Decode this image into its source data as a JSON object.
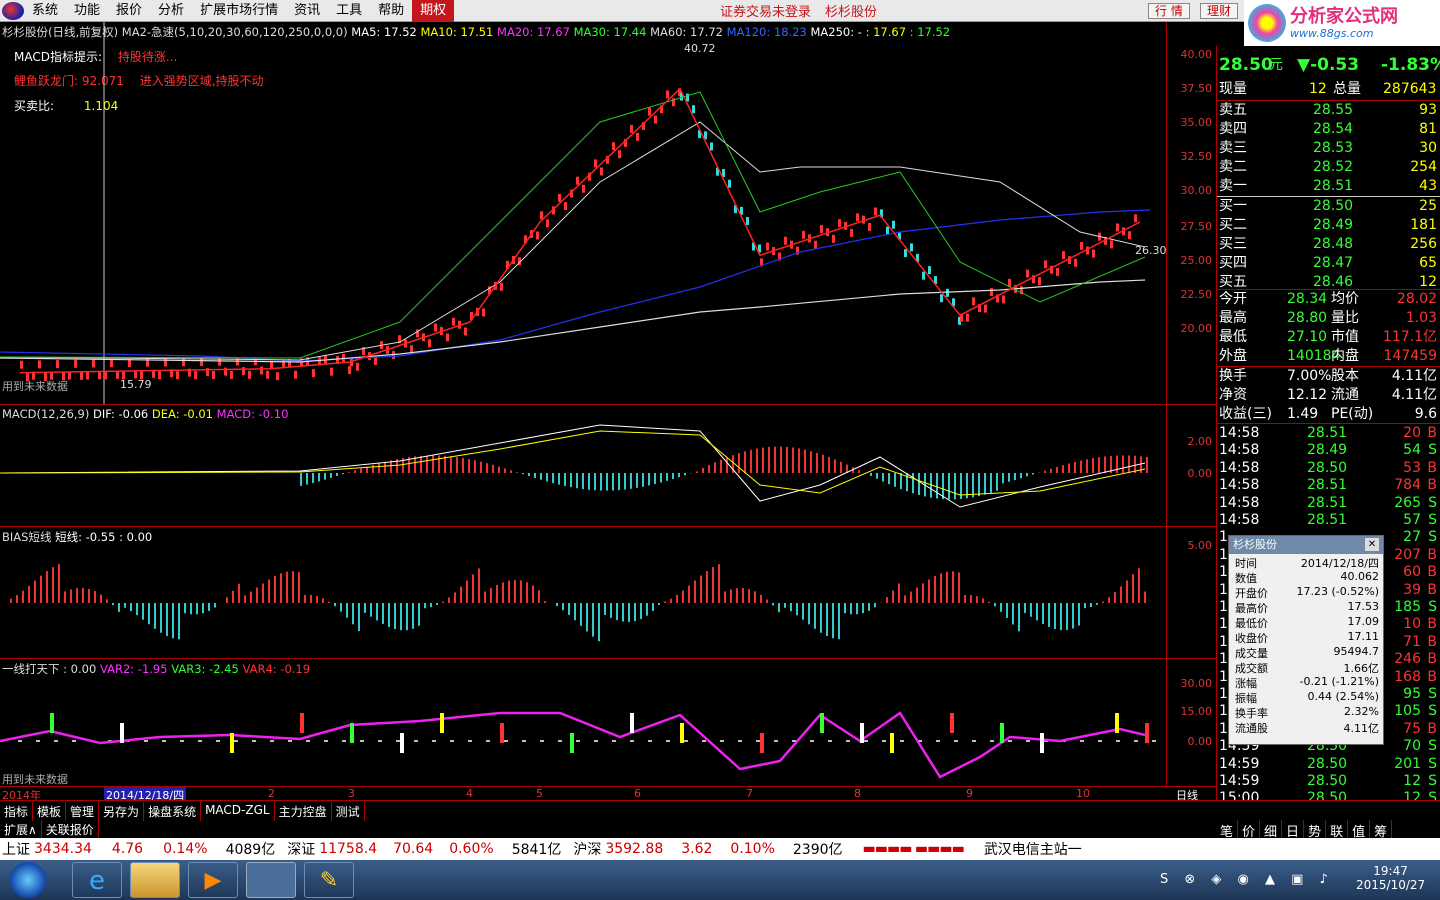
{
  "menu": {
    "items": [
      "系统",
      "功能",
      "报价",
      "分析",
      "扩展市场行情",
      "资讯",
      "工具",
      "帮助"
    ],
    "highlight": "期权",
    "notice1": "证券交易未登录",
    "notice2": "杉杉股份",
    "btn_quote": "行 情",
    "btn_trade": "理财"
  },
  "logo": {
    "title": "分析家公式网",
    "url": "www.88gs.com"
  },
  "main_panel": {
    "title": "杉杉股份(日线,前复权) MA2-急速(5,10,20,30,60,120,250,0,0,0)",
    "ma5": "MA5: 17.52",
    "ma10": "MA10: 17.51",
    "ma20": "MA20: 17.67",
    "ma30": "MA30: 17.44",
    "ma60": "MA60: 17.72",
    "ma120": "MA120: 18.23",
    "ma250": "MA250: -",
    "v1": ": 17.67",
    "v2": ": 17.52",
    "hint_label": "MACD指标提示:",
    "hint_value": "持股待涨...",
    "dragon_label": "鲤鱼跃龙门: 92.071",
    "dragon_value": "进入强势区域,持股不动",
    "ratio_label": "买卖比:",
    "ratio_value": "1.104",
    "future_note": "用到未来数据",
    "high_mark": "40.72",
    "low_mark": "15.79",
    "right_mark": "26.30",
    "ticks": [
      "40.00",
      "37.50",
      "35.00",
      "32.50",
      "30.00",
      "27.50",
      "25.00",
      "22.50",
      "20.00"
    ]
  },
  "macd_panel": {
    "title": "MACD(12,26,9)",
    "dif": "DIF: -0.06",
    "dea": "DEA: -0.01",
    "macd": "MACD: -0.10",
    "ticks": [
      "2.00",
      "0.00"
    ]
  },
  "bias_panel": {
    "title": "BIAS短线",
    "short": "短线: -0.55",
    "v0": ": 0.00",
    "ticks": [
      "5.00"
    ]
  },
  "var_panel": {
    "title": "一线打天下 : 0.00",
    "var2": "VAR2: -1.95",
    "var3": "VAR3: -2.45",
    "var4": "VAR4: -0.19",
    "future_note": "用到未来数据",
    "ticks": [
      "30.00",
      "15.00",
      "0.00"
    ]
  },
  "date_axis": {
    "year": "2014年",
    "cursor_date": "2014/12/18/四",
    "months": [
      "2",
      "3",
      "4",
      "5",
      "6",
      "7",
      "8",
      "9",
      "10"
    ],
    "period": "日线"
  },
  "chart_data": {
    "type": "line",
    "title": "",
    "x_months": [
      "2014-12",
      "2015-02",
      "2015-03",
      "2015-04",
      "2015-05",
      "2015-06",
      "2015-07",
      "2015-08",
      "2015-09",
      "2015-10"
    ],
    "series": [
      {
        "name": "收盘价",
        "values": [
          17.2,
          17.5,
          18.0,
          21.0,
          28.5,
          38.5,
          26.0,
          29.0,
          21.5,
          28.5
        ]
      }
    ],
    "ylim": [
      15,
      42
    ]
  },
  "bottom_tabs": {
    "row1": [
      "指标",
      "模板",
      "管理",
      "另存为",
      "操盘系统",
      "MACD-ZGL",
      "主力控盘",
      "测试"
    ],
    "row2": [
      "扩展∧",
      "关联报价"
    ],
    "right_tabs": [
      "笔",
      "价",
      "细",
      "日",
      "势",
      "联",
      "值",
      "筹"
    ]
  },
  "quote": {
    "price": "28.50",
    "unit": "元",
    "change": "▼-0.53",
    "pct": "-1.83%",
    "xianliang_label": "现量",
    "xianliang": "12",
    "zongliang_label": "总量",
    "zongliang": "287643",
    "sells": [
      {
        "label": "卖五",
        "price": "28.55",
        "vol": "93"
      },
      {
        "label": "卖四",
        "price": "28.54",
        "vol": "81"
      },
      {
        "label": "卖三",
        "price": "28.53",
        "vol": "30"
      },
      {
        "label": "卖二",
        "price": "28.52",
        "vol": "254"
      },
      {
        "label": "卖一",
        "price": "28.51",
        "vol": "43"
      }
    ],
    "buys": [
      {
        "label": "买一",
        "price": "28.50",
        "vol": "25"
      },
      {
        "label": "买二",
        "price": "28.49",
        "vol": "181"
      },
      {
        "label": "买三",
        "price": "28.48",
        "vol": "256"
      },
      {
        "label": "买四",
        "price": "28.47",
        "vol": "65"
      },
      {
        "label": "买五",
        "price": "28.46",
        "vol": "12"
      }
    ],
    "stats": [
      {
        "l1": "今开",
        "v1": "28.34",
        "l2": "均价",
        "v2": "28.02"
      },
      {
        "l1": "最高",
        "v1": "28.80",
        "l2": "量比",
        "v2": "1.03"
      },
      {
        "l1": "最低",
        "v1": "27.10",
        "l2": "市值",
        "v2": "117.1亿"
      },
      {
        "l1": "外盘",
        "v1": "140184",
        "l2": "内盘",
        "v2": "147459"
      }
    ],
    "stats2": [
      {
        "l1": "换手",
        "v1": "7.00%",
        "l2": "股本",
        "v2": "4.11亿"
      },
      {
        "l1": "净资",
        "v1": "12.12",
        "l2": "流通",
        "v2": "4.11亿"
      },
      {
        "l1": "收益(三)",
        "v1": "1.49",
        "l2": "PE(动)",
        "v2": "9.6"
      }
    ],
    "ticks": [
      {
        "t": "14:58",
        "p": "28.51",
        "v": "20",
        "d": "B"
      },
      {
        "t": "14:58",
        "p": "28.49",
        "v": "54",
        "d": "S"
      },
      {
        "t": "14:58",
        "p": "28.50",
        "v": "53",
        "d": "B"
      },
      {
        "t": "14:58",
        "p": "28.51",
        "v": "784",
        "d": "B"
      },
      {
        "t": "14:58",
        "p": "28.51",
        "v": "265",
        "d": "S"
      },
      {
        "t": "14:58",
        "p": "28.51",
        "v": "57",
        "d": "S"
      },
      {
        "t": "1",
        "p": "",
        "v": "27",
        "d": "S"
      },
      {
        "t": "1",
        "p": "",
        "v": "207",
        "d": "B"
      },
      {
        "t": "1",
        "p": "",
        "v": "60",
        "d": "B"
      },
      {
        "t": "1",
        "p": "",
        "v": "39",
        "d": "B"
      },
      {
        "t": "1",
        "p": "",
        "v": "185",
        "d": "S"
      },
      {
        "t": "1",
        "p": "",
        "v": "10",
        "d": "B"
      },
      {
        "t": "1",
        "p": "",
        "v": "71",
        "d": "B"
      },
      {
        "t": "1",
        "p": "",
        "v": "246",
        "d": "B"
      },
      {
        "t": "1",
        "p": "",
        "v": "168",
        "d": "B"
      },
      {
        "t": "1",
        "p": "",
        "v": "95",
        "d": "S"
      },
      {
        "t": "1",
        "p": "",
        "v": "105",
        "d": "S"
      },
      {
        "t": "1",
        "p": "",
        "v": "75",
        "d": "B"
      },
      {
        "t": "14:59",
        "p": "28.50",
        "v": "70",
        "d": "S"
      },
      {
        "t": "14:59",
        "p": "28.50",
        "v": "201",
        "d": "S"
      },
      {
        "t": "14:59",
        "p": "28.50",
        "v": "12",
        "d": "S"
      },
      {
        "t": "15:00",
        "p": "28.50",
        "v": "12",
        "d": "S"
      }
    ]
  },
  "popup": {
    "title": "杉杉股份",
    "rows": [
      {
        "k": "时间",
        "v": "2014/12/18/四"
      },
      {
        "k": "数值",
        "v": "40.062"
      },
      {
        "k": "开盘价",
        "v": "17.23 (-0.52%)"
      },
      {
        "k": "最高价",
        "v": "17.53"
      },
      {
        "k": "最低价",
        "v": "17.09"
      },
      {
        "k": "收盘价",
        "v": "17.11"
      },
      {
        "k": "成交量",
        "v": "95494.7"
      },
      {
        "k": "成交额",
        "v": "1.66亿"
      },
      {
        "k": "涨幅",
        "v": "-0.21 (-1.21%)"
      },
      {
        "k": "振幅",
        "v": "0.44 (2.54%)"
      },
      {
        "k": "换手率",
        "v": "2.32%"
      },
      {
        "k": "流通股",
        "v": "4.11亿"
      }
    ]
  },
  "status": {
    "sh_label": "上证",
    "sh_val": "3434.34",
    "sh_chg": "4.76",
    "sh_pct": "0.14%",
    "sh_amt": "4089亿",
    "sz_label": "深证",
    "sz_val": "11758.4",
    "sz_chg": "70.64",
    "sz_pct": "0.60%",
    "sz_amt": "5841亿",
    "hs_label": "沪深",
    "hs_val": "3592.88",
    "hs_chg": "3.62",
    "hs_pct": "0.10%",
    "hs_amt": "2390亿",
    "server": "武汉电信主站一"
  },
  "taskbar": {
    "time": "19:47",
    "date": "2015/10/27"
  }
}
